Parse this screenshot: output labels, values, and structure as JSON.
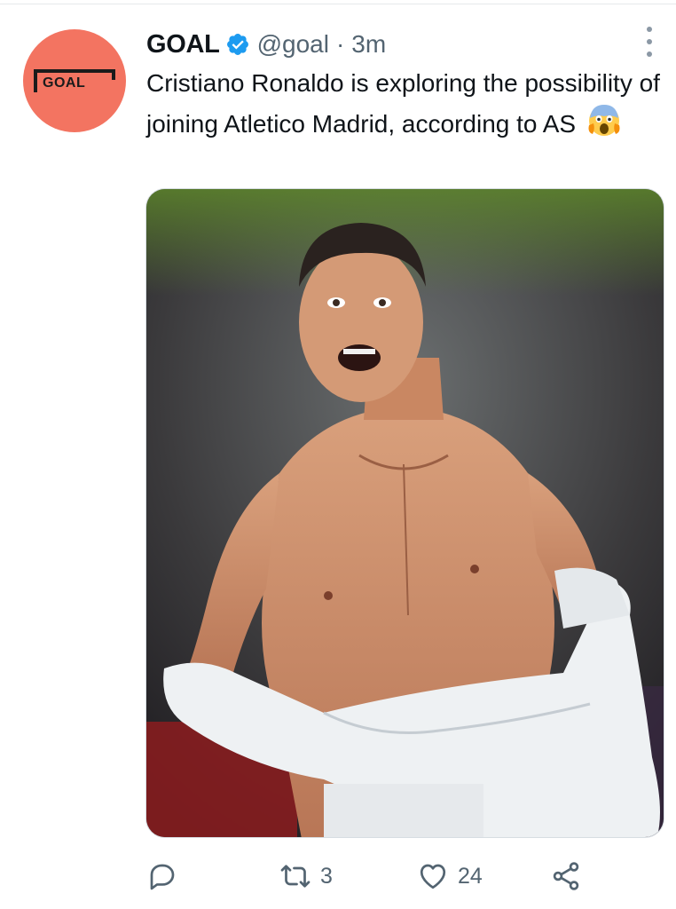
{
  "tweet": {
    "author_name": "GOAL",
    "handle": "@goal",
    "separator": "·",
    "time": "3m",
    "text": "Cristiano Ronaldo is exploring the possibility of joining Atletico Madrid, according to AS",
    "emoji": "😱",
    "avatar_text": "GOAL"
  },
  "actions": {
    "reply_icon": "reply-icon",
    "retweet_icon": "retweet-icon",
    "retweet_count": "3",
    "like_icon": "heart-icon",
    "like_count": "24",
    "share_icon": "share-icon"
  },
  "colors": {
    "avatar_bg": "#f37461",
    "verified": "#1d9bf0",
    "secondary_text": "#536471"
  }
}
